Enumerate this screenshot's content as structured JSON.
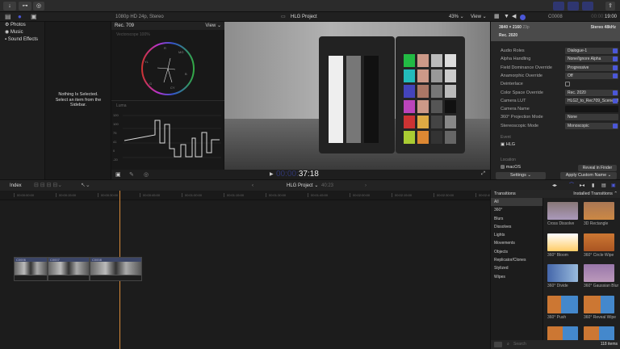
{
  "toolbar": {
    "import_icon": "download-icon",
    "keywords_icon": "key-icon",
    "background_tasks_icon": "check-circle-icon",
    "share_icon": "share-icon"
  },
  "sidebar": {
    "items": [
      {
        "label": "Photos"
      },
      {
        "label": "Music"
      },
      {
        "label": "Sound Effects"
      }
    ]
  },
  "browser": {
    "empty_message": "Nothing Is Selected. Select an item from the Sidebar."
  },
  "viewer": {
    "format": "1080p HD 24p, Stereo",
    "project": "HLG Project",
    "zoom": "43%",
    "view_label": "View",
    "timecode_dim": "00:00:",
    "timecode": "37:18"
  },
  "scopes": {
    "color_space": "Rec. 709",
    "view_label": "View",
    "vectorscope_label": "Vectorscope 100%",
    "luma_label": "Luma",
    "luma_ticks": [
      "120",
      "100",
      "75",
      "41",
      "0",
      "-20"
    ],
    "vector_labels": [
      "R",
      "MG",
      "B",
      "CY",
      "G",
      "YL"
    ]
  },
  "inspector": {
    "clip_name": "C0008",
    "duration_dim": "00:00:",
    "duration": "19:00",
    "resolution": "3840 × 2160",
    "fps": "23p",
    "audio": "Stereo 48kHz",
    "color_space": "Rec. 2020",
    "rows": [
      {
        "label": "Audio Roles",
        "value": "Dialogue-1"
      },
      {
        "label": "Alpha Handling",
        "value": "None/Ignore Alpha"
      },
      {
        "label": "Field Dominance Override",
        "value": "Progressive"
      },
      {
        "label": "Anamorphic Override",
        "value": "Off"
      },
      {
        "label": "Deinterlace",
        "value": ""
      },
      {
        "label": "Color Space Override",
        "value": "Rec. 2020"
      },
      {
        "label": "Camera LUT",
        "value": "HLG2_to_Rec709_Scene_D..."
      },
      {
        "label": "Camera Name",
        "value": ""
      },
      {
        "label": "360° Projection Mode",
        "value": "None"
      },
      {
        "label": "Stereoscopic Mode",
        "value": "Monoscopic"
      }
    ],
    "event_label": "Event",
    "event_value": "HLG",
    "location_label": "Location",
    "location_value": "macOS",
    "reveal_button": "Reveal in Finder",
    "settings_button": "Settings ⌄",
    "apply_name_button": "Apply Custom Name ⌄"
  },
  "timeline": {
    "index_label": "Index",
    "project": "HLG Project ⌄",
    "duration": "40:23",
    "ruler": [
      "00:00:00:00",
      "00:00:15:00",
      "00:00:30:00",
      "00:00:45:00",
      "00:01:00:00",
      "00:01:15:00",
      "00:01:30:00",
      "00:01:45:00",
      "00:02:00:00",
      "00:02:15:00",
      "00:02:30:00",
      "00:02:45:00"
    ],
    "clips": [
      {
        "name": "C0006"
      },
      {
        "name": "C0007"
      },
      {
        "name": "C0008"
      }
    ]
  },
  "transitions": {
    "title": "Transitions",
    "filter": "Installed Transitions ⌃",
    "categories": [
      "All",
      "360°",
      "Blurs",
      "Dissolves",
      "Lights",
      "Movements",
      "Objects",
      "Replicator/Clones",
      "Stylized",
      "Wipes"
    ],
    "items": [
      {
        "name": "Cross Dissolve"
      },
      {
        "name": "3D Rectangle"
      },
      {
        "name": "360° Bloom"
      },
      {
        "name": "360° Circle Wipe"
      },
      {
        "name": "360° Divide"
      },
      {
        "name": "360° Gaussian Blur"
      },
      {
        "name": "360° Push"
      },
      {
        "name": "360° Reveal Wipe"
      }
    ],
    "search_placeholder": "Search",
    "count": "118 items"
  },
  "colors": {
    "accent": "#4b57d8",
    "playhead": "#d88a3a",
    "selection": "#3a3a3a"
  }
}
